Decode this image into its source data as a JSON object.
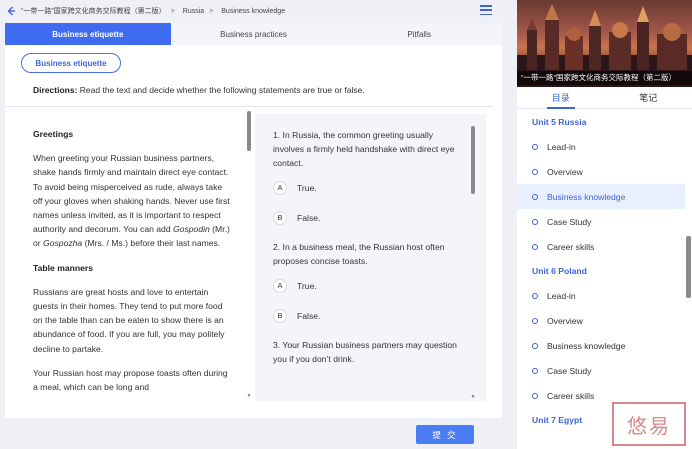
{
  "header": {
    "book_title": "“一带一路”国家跨文化商务交际教程（第二版）",
    "breadcrumb": [
      "Russia",
      "Business knowledge"
    ],
    "separator": ">"
  },
  "tabs": [
    {
      "label": "Business etiquette",
      "active": true
    },
    {
      "label": "Business practices",
      "active": false
    },
    {
      "label": "Pitfalls",
      "active": false
    }
  ],
  "section_pill": "Business etiquette",
  "directions": {
    "label": "Directions:",
    "text": "Read the text and decide whether the following statements are true or false."
  },
  "passage": {
    "heading1": "Greetings",
    "para1_before_i1": "When greeting your Russian business partners, shake hands firmly and maintain direct eye contact. To avoid being misperceived as rude, always take off your gloves when shaking hands. Never use first names unless invited, as it is important to respect authority and decorum. You can add ",
    "italic1": "Gospodin",
    "para1_mid": " (Mr.) or ",
    "italic2": "Gospozha",
    "para1_after": " (Mrs. / Ms.) before their last names.",
    "heading2": "Table manners",
    "para2": "Russians are great hosts and love to entertain guests in their homes. They tend to put more food on the table than can be eaten to show there is an abundance of food. If you are full, you may politely decline to partake.",
    "para3": "Your Russian host may propose toasts often during a meal, which can be long and"
  },
  "questions": [
    {
      "text": "1. In Russia, the common greeting usually involves a firmly held handshake with direct eye contact.",
      "options": [
        {
          "letter": "A",
          "label": "True."
        },
        {
          "letter": "B",
          "label": "False."
        }
      ]
    },
    {
      "text": "2.  In a business meal, the Russian host often proposes concise toasts.",
      "options": [
        {
          "letter": "A",
          "label": "True."
        },
        {
          "letter": "B",
          "label": "False."
        }
      ]
    },
    {
      "text": "3. Your Russian business partners may question you if you don’t drink.",
      "options": []
    }
  ],
  "submit_label": "提 交",
  "sidebar": {
    "cover_title": "“一带一路”国家跨文化商务交际教程（第二版）",
    "tabs": [
      "目录",
      "笔记"
    ],
    "units": [
      {
        "title": "Unit 5 Russia",
        "lessons": [
          "Lead-in",
          "Overview",
          "Business knowledge",
          "Case Study",
          "Career skills"
        ]
      },
      {
        "title": "Unit 6 Poland",
        "lessons": [
          "Lead-in",
          "Overview",
          "Business knowledge",
          "Case Study",
          "Career skills"
        ]
      },
      {
        "title": "Unit 7 Egypt",
        "lessons": []
      }
    ],
    "active_lesson": "Unit 5 Russia / Business knowledge"
  },
  "watermark_text": "悠易",
  "colors": {
    "accent": "#3e6bf0",
    "accent_text": "#3e63d6",
    "panel_bg": "#f4f5f9"
  }
}
